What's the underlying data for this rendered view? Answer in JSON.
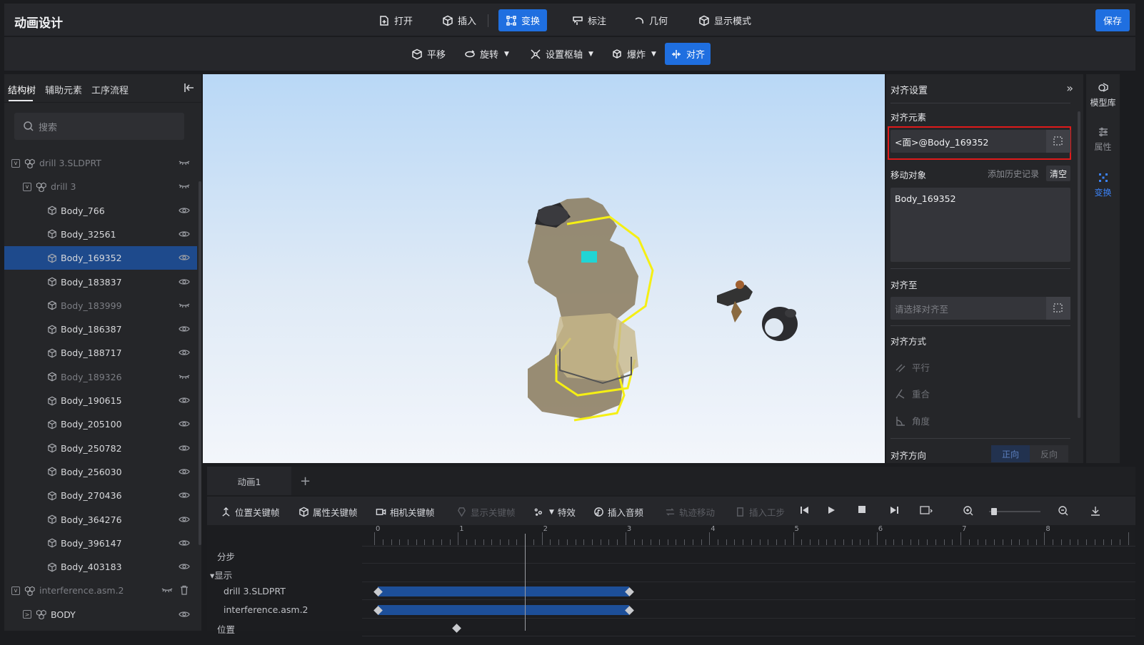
{
  "app": {
    "title": "动画设计",
    "save": "保存"
  },
  "toolbar": [
    {
      "label": "打开",
      "icon": "open-file-icon"
    },
    {
      "label": "插入",
      "icon": "cube-insert-icon"
    },
    {
      "label": "变换",
      "icon": "transform-icon",
      "active": true
    },
    {
      "label": "标注",
      "icon": "annotation-icon"
    },
    {
      "label": "几何",
      "icon": "arc-icon"
    },
    {
      "label": "显示模式",
      "icon": "cube-display-icon"
    }
  ],
  "subtoolbar": [
    {
      "label": "平移",
      "icon": "move-icon"
    },
    {
      "label": "旋转",
      "icon": "rotate-icon",
      "dropdown": true
    },
    {
      "label": "设置枢轴",
      "icon": "pivot-icon",
      "dropdown": true
    },
    {
      "label": "爆炸",
      "icon": "explode-icon",
      "dropdown": true
    },
    {
      "label": "对齐",
      "icon": "align-icon",
      "active": true
    }
  ],
  "left": {
    "tabs": [
      "结构树",
      "辅助元素",
      "工序流程"
    ],
    "search_placeholder": "搜索",
    "tree": [
      {
        "label": "drill 3.SLDPRT",
        "level": 0,
        "expand": true,
        "hidden": true,
        "dim": true
      },
      {
        "label": "drill 3",
        "level": 1,
        "expand": true,
        "hidden": true,
        "dim": true
      },
      {
        "label": "Body_766",
        "level": 2
      },
      {
        "label": "Body_32561",
        "level": 2
      },
      {
        "label": "Body_169352",
        "level": 2,
        "selected": true
      },
      {
        "label": "Body_183837",
        "level": 2
      },
      {
        "label": "Body_183999",
        "level": 2,
        "hidden": true,
        "dim": true
      },
      {
        "label": "Body_186387",
        "level": 2
      },
      {
        "label": "Body_188717",
        "level": 2
      },
      {
        "label": "Body_189326",
        "level": 2,
        "hidden": true,
        "dim": true
      },
      {
        "label": "Body_190615",
        "level": 2
      },
      {
        "label": "Body_205100",
        "level": 2
      },
      {
        "label": "Body_250782",
        "level": 2
      },
      {
        "label": "Body_256030",
        "level": 2
      },
      {
        "label": "Body_270436",
        "level": 2
      },
      {
        "label": "Body_364276",
        "level": 2
      },
      {
        "label": "Body_396147",
        "level": 2
      },
      {
        "label": "Body_403183",
        "level": 2
      },
      {
        "label": "interference.asm.2",
        "level": 0,
        "expand": true,
        "hidden": true,
        "dim": true,
        "trash": true
      },
      {
        "label": "BODY",
        "level": 1,
        "expand": true
      }
    ]
  },
  "right": {
    "title": "对齐设置",
    "align_element_label": "对齐元素",
    "align_element_value": "<面>@Body_169352",
    "move_object_label": "移动对象",
    "add_history": "添加历史记录",
    "clear": "清空",
    "move_object_value": "Body_169352",
    "align_to_label": "对齐至",
    "align_to_placeholder": "请选择对齐至",
    "align_mode_label": "对齐方式",
    "modes": [
      "平行",
      "重合",
      "角度"
    ],
    "direction_label": "对齐方向",
    "directions": [
      "正向",
      "反向"
    ]
  },
  "dock": [
    "模型库",
    "属性",
    "变换"
  ],
  "timeline": {
    "tab": "动画1",
    "tools": [
      {
        "label": "位置关键帧",
        "icon": "position-key-icon"
      },
      {
        "label": "属性关键帧",
        "icon": "property-key-icon"
      },
      {
        "label": "相机关键帧",
        "icon": "camera-icon"
      },
      {
        "label": "显示关键帧",
        "icon": "display-key-icon",
        "disabled": true
      },
      {
        "label": "特效",
        "icon": "effects-icon",
        "dropdown": true
      },
      {
        "label": "插入音频",
        "icon": "audio-icon"
      },
      {
        "label": "轨迹移动",
        "icon": "track-move-icon",
        "disabled": true
      },
      {
        "label": "插入工步",
        "icon": "insert-step-icon",
        "disabled": true
      }
    ],
    "ruler_labels": [
      "0",
      "1",
      "2",
      "3",
      "4",
      "5",
      "6",
      "7",
      "8"
    ],
    "tracks": [
      "分步",
      "▾显示",
      "drill 3.SLDPRT",
      "interference.asm.2",
      "位置"
    ],
    "playhead_seconds": 1.8,
    "display_bars_seconds": [
      0,
      3
    ]
  }
}
